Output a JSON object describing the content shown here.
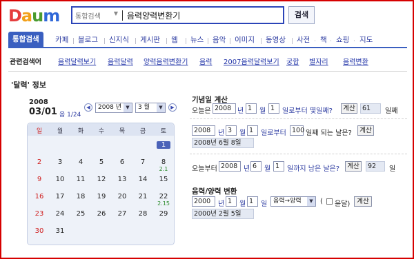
{
  "logo": {
    "letters": [
      "D",
      "a",
      "u",
      "m"
    ],
    "colors": [
      "#e53c3c",
      "#f2a019",
      "#4a9b2f",
      "#2f67d8"
    ]
  },
  "search": {
    "scope_label": "통합검색",
    "scope_arrow": "▼",
    "query": "음력양력변환기",
    "button_label": "검색"
  },
  "tabs": [
    "통합검색",
    "카페",
    "블로그",
    "신지식",
    "게시판",
    "웹",
    "뉴스",
    "음악",
    "이미지",
    "동영상",
    "사전",
    "책",
    "쇼핑",
    "지도"
  ],
  "related": {
    "label": "관련검색어",
    "items": [
      "음력달력보기",
      "음력달력",
      "양력음력변환기",
      "음력",
      "2007음력달력보기",
      "궁합",
      "별자리",
      "음력변환"
    ]
  },
  "section_title": "'달력' 정보",
  "calendar": {
    "year": "2008",
    "date": "03/01",
    "lunar_label": "음 1/24",
    "year_select": "2008 년",
    "month_select": "3 월",
    "prev_icon": "◀",
    "next_icon": "▶",
    "weekdays": [
      "일",
      "월",
      "화",
      "수",
      "목",
      "금",
      "토"
    ],
    "rows": [
      [
        "",
        "",
        "",
        "",
        "",
        "",
        "1"
      ],
      [
        "2",
        "3",
        "4",
        "5",
        "6",
        "7",
        "8"
      ],
      [
        "9",
        "10",
        "11",
        "12",
        "13",
        "14",
        "15"
      ],
      [
        "16",
        "17",
        "18",
        "19",
        "20",
        "21",
        "22"
      ],
      [
        "23",
        "24",
        "25",
        "26",
        "27",
        "28",
        "29"
      ],
      [
        "30",
        "31",
        "",
        "",
        "",
        "",
        ""
      ]
    ],
    "lunar_notes": {
      "8": "2.1",
      "22": "2.15"
    }
  },
  "anniv": {
    "title": "기념일 계산",
    "l1": {
      "prefix": "오늘은",
      "year": "2008",
      "year_unit": "년",
      "month": "1",
      "month_unit": "월",
      "day": "1",
      "day_unit": "일로부터 몇일째?",
      "button": "계산",
      "result": "61",
      "result_unit": "일째"
    },
    "l2": {
      "year": "2008",
      "year_unit": "년",
      "month": "3",
      "month_unit": "월",
      "day": "1",
      "day_unit": "일로부터",
      "days": "100",
      "days_unit": "일째 되는 날은?",
      "button": "계산",
      "result": "2008년 6월 8일"
    },
    "l3": {
      "prefix": "오늘부터",
      "year": "2008",
      "year_unit": "년",
      "month": "6",
      "month_unit": "월",
      "day": "1",
      "day_unit": "일까지 남은 날은?",
      "button": "계산",
      "result": "92",
      "result_unit": "일"
    }
  },
  "convert": {
    "title": "음력/양력 변환",
    "year": "2000",
    "year_unit": "년",
    "month": "1",
    "month_unit": "월",
    "day": "1",
    "day_unit": "일",
    "mode": "음력→양력",
    "paren_open": "(",
    "leap_label": "윤달)",
    "button": "계산",
    "result": "2000년 2월 5일"
  }
}
